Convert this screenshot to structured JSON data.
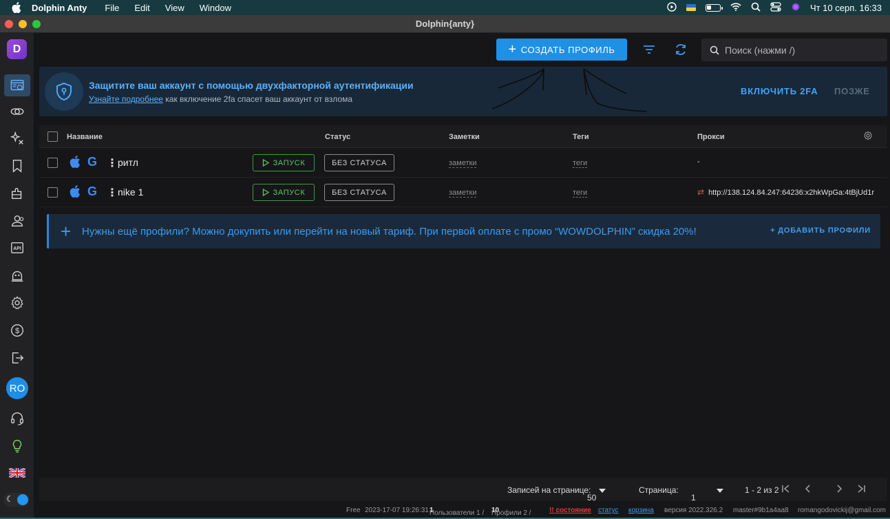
{
  "menubar": {
    "app_name": "Dolphin Anty",
    "items": [
      "File",
      "Edit",
      "View",
      "Window"
    ],
    "datetime": "Чт 10 серп.  16:33"
  },
  "window": {
    "title": "Dolphin{anty}"
  },
  "sidebar": {
    "logo_letter": "D",
    "avatar_initials": "RO"
  },
  "toolbar": {
    "create_label": "СОЗДАТЬ ПРОФИЛЬ",
    "search_placeholder": "Поиск (нажми /)"
  },
  "banner": {
    "title": "Защитите ваш аккаунт с помощью двухфакторной аутентификации",
    "link_text": "Узнайте подробнее",
    "sub_text": " как включение 2fa спасет ваш аккаунт от взлома",
    "enable_label": "ВКЛЮЧИТЬ 2FA",
    "later_label": "ПОЗЖЕ"
  },
  "table": {
    "headers": {
      "name": "Название",
      "status": "Статус",
      "notes": "Заметки",
      "tags": "Теги",
      "proxy": "Прокси"
    },
    "rows": [
      {
        "name": "ритл",
        "run_label": "ЗАПУСК",
        "status_label": "БЕЗ СТАТУСА",
        "notes": "заметки",
        "tags": "теги",
        "proxy": "-"
      },
      {
        "name": "nike 1",
        "run_label": "ЗАПУСК",
        "status_label": "БЕЗ СТАТУСА",
        "notes": "заметки",
        "tags": "теги",
        "proxy": "http://138.124.84.247:64236:x2hkWpGa:4tBjUd1r"
      }
    ]
  },
  "upsell": {
    "text": "Нужны ещё профили? Можно докупить или перейти на новый тариф. При первой оплате с промо “WOWDOLPHIN” скидка 20%!",
    "add_label": "+ ДОБАВИТЬ ПРОФИЛИ"
  },
  "pager": {
    "per_page_label": "Записей на странице:",
    "per_page_value": "50",
    "page_label": "Страница:",
    "page_value": "1",
    "range": "1 - 2 из 2"
  },
  "statusbar": {
    "plan": "Free",
    "date": "2023-17-07 19:26:31",
    "users_label": "Пользователи 1 /",
    "users_total": "1",
    "profiles_label": "Профили 2 /",
    "profiles_total": "10",
    "state": "!! состояние",
    "status": "статус",
    "cart": "корзина",
    "version": "версия 2022.326.2",
    "build": "master#9b1a4aa8",
    "email": "romangodovickij@gmail.com"
  },
  "colors": {
    "accent": "#1e90e6",
    "run": "#5ec766",
    "warn": "#e23b3b"
  }
}
